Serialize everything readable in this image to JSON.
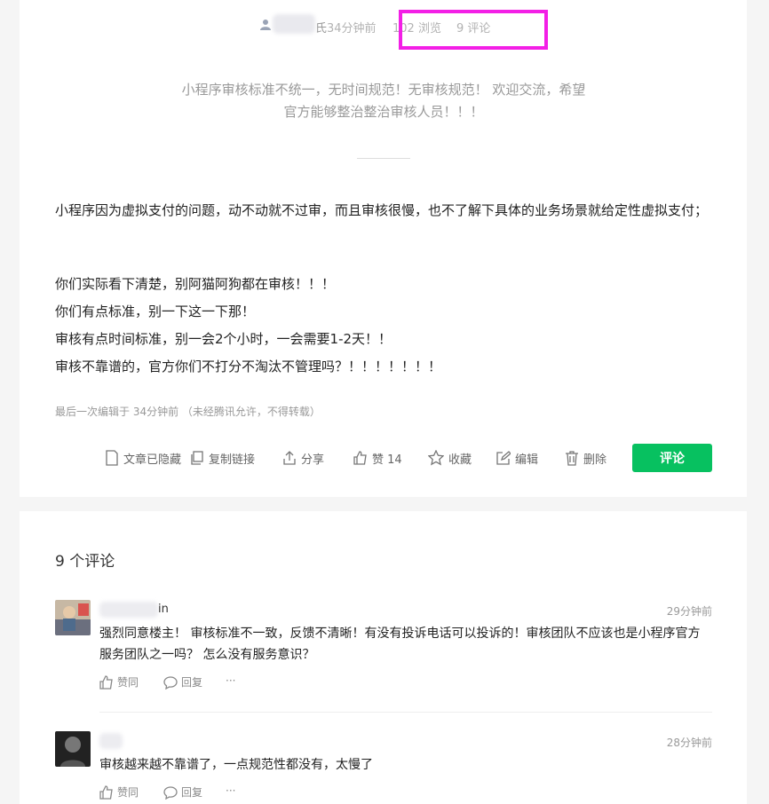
{
  "post": {
    "meta": {
      "author_suffix": "氏",
      "time": "34分钟前",
      "views": "102 浏览",
      "comments": "9 评论"
    },
    "summary": "小程序审核标准不统一，无时间规范！无审核规范！ 欢迎交流，希望官方能够整治整治审核人员！！！",
    "body": [
      "小程序因为虚拟支付的问题，动不动就不过审，而且审核很慢，也不了解下具体的业务场景就给定性虚拟支付；",
      "你们实际看下清楚，别阿猫阿狗都在审核！！！",
      "你们有点标准，别一下这一下那！",
      "审核有点时间标准，别一会2个小时，一会需要1-2天！！",
      "审核不靠谱的，官方你们不打分不淘汰不管理吗？！！！！！！！"
    ],
    "edit_note": "最后一次编辑于  34分钟前  （未经腾讯允许，不得转载）",
    "actions": {
      "hidden": "文章已隐藏",
      "copy_link": "复制链接",
      "share": "分享",
      "like": "赞 14",
      "favorite": "收藏",
      "edit": "编辑",
      "delete": "删除",
      "comment_button": "评论"
    }
  },
  "comments_section": {
    "title": "9 个评论",
    "items": [
      {
        "name_suffix": "in",
        "time": "29分钟前",
        "text": "强烈同意楼主！ 审核标准不一致，反馈不清晰！有没有投诉电话可以投诉的！审核团队不应该也是小程序官方服务团队之一吗？ 怎么没有服务意识？",
        "agree": "赞同",
        "reply": "回复",
        "more": "···"
      },
      {
        "name_suffix": "",
        "time": "28分钟前",
        "text": "审核越来越不靠谱了，一点规范性都没有，太慢了",
        "agree": "赞同",
        "reply": "回复",
        "more": "···"
      }
    ]
  },
  "colors": {
    "accent": "#07c160",
    "highlight": "#f31fe6",
    "muted": "#999999"
  }
}
